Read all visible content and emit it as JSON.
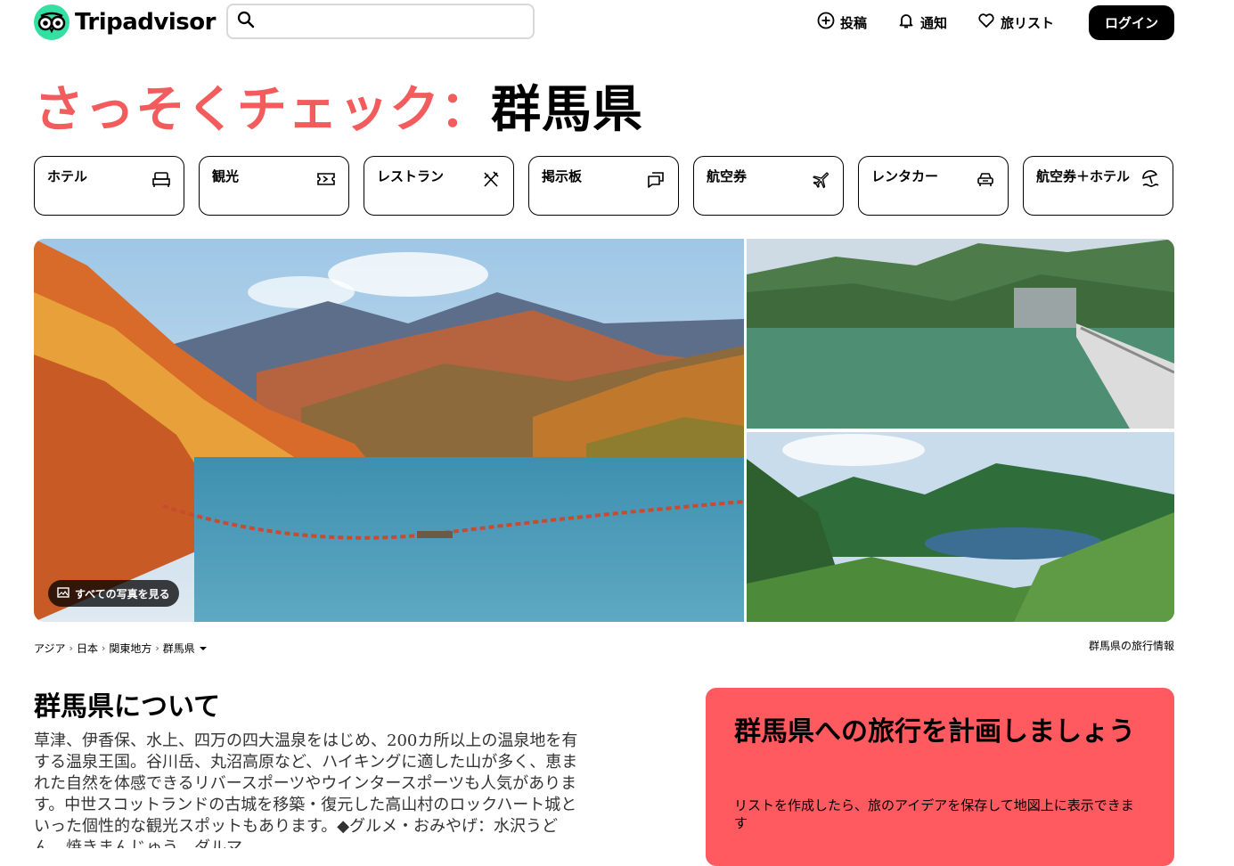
{
  "header": {
    "brand": "Tripadvisor",
    "search_placeholder": "",
    "nav": {
      "post": "投稿",
      "notify": "通知",
      "trips": "旅リスト"
    },
    "login": "ログイン"
  },
  "title": {
    "accent": "さっそくチェック：",
    "place": "群馬県"
  },
  "categories": [
    {
      "label": "ホテル",
      "icon": "bed-icon"
    },
    {
      "label": "観光",
      "icon": "ticket-icon"
    },
    {
      "label": "レストラン",
      "icon": "utensils-icon"
    },
    {
      "label": "掲示板",
      "icon": "chat-icon"
    },
    {
      "label": "航空券",
      "icon": "plane-icon"
    },
    {
      "label": "レンタカー",
      "icon": "car-icon"
    },
    {
      "label": "航空券＋ホテル",
      "icon": "beach-umbrella-icon"
    }
  ],
  "photos": {
    "see_all": "すべての写真を見る"
  },
  "breadcrumbs": [
    "アジア",
    "日本",
    "関東地方",
    "群馬県"
  ],
  "travel_info": "群馬県の旅行情報",
  "about": {
    "heading": "群馬県について",
    "body": "草津、伊香保、水上、四万の四大温泉をはじめ、200カ所以上の温泉地を有する温泉王国。谷川岳、丸沼高原など、ハイキングに適した山が多く、恵まれた自然を体感できるリバースポーツやウインタースポーツも人気があります。中世スコットランドの古城を移築・復元した高山村のロックハート城といった個性的な観光スポットもあります。◆グルメ・おみやげ：水沢うどん、焼きまんじゅう、ダルマ"
  },
  "plan": {
    "heading": "群馬県への旅行を計画しましょう",
    "body": "リストを作成したら、旅のアイデアを保存して地図上に表示できます"
  },
  "colors": {
    "accent": "#f25c5c",
    "plan_bg": "#ff5a5f",
    "brand_green": "#34e0a1"
  }
}
